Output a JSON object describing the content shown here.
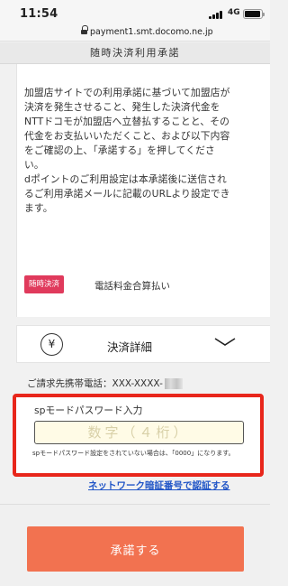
{
  "status_bar": {
    "time": "11:54",
    "network": "4G",
    "icons": [
      "signal-icon",
      "battery-icon"
    ]
  },
  "browser": {
    "url": "payment1.smt.docomo.ne.jp",
    "icons": [
      "lock-icon"
    ]
  },
  "header": {
    "title": "随時決済利用承諾"
  },
  "consent": {
    "text": "加盟店サイトでの利用承諾に基づいて加盟店が\n決済を発生させること、発生した決済代金を\nNTTドコモが加盟店へ立替払することと、その\n代金をお支払いいただくこと、および以下内容\nをご確認の上、「承諾する」を押してくださ\nい。\ndポイントのご利用設定は本承諾後に送信され\nるご利用承諾メールに記載のURLより設定でき\nます。",
    "badge": "随時決済",
    "payment_method": "電話料金合算払い"
  },
  "details": {
    "label": "決済詳細",
    "icons": [
      "yen-icon",
      "chevron-down-icon"
    ]
  },
  "billing": {
    "phone_label": "ご請求先携帯電話：XXX-XXXX-"
  },
  "password": {
    "label": "spモードパスワード入力",
    "placeholder": "数字（４桁）",
    "value": "",
    "note": "spモードパスワード設定をされていない場合は、「0000」になります。"
  },
  "network_link": "ネットワーク暗証番号で認証する",
  "accept_button": "承諾する",
  "colors": {
    "badge": "#e03a5c",
    "highlight": "#e8261b",
    "accept": "#f27250",
    "link": "#2256c7",
    "input_bg": "#fffbe6"
  }
}
